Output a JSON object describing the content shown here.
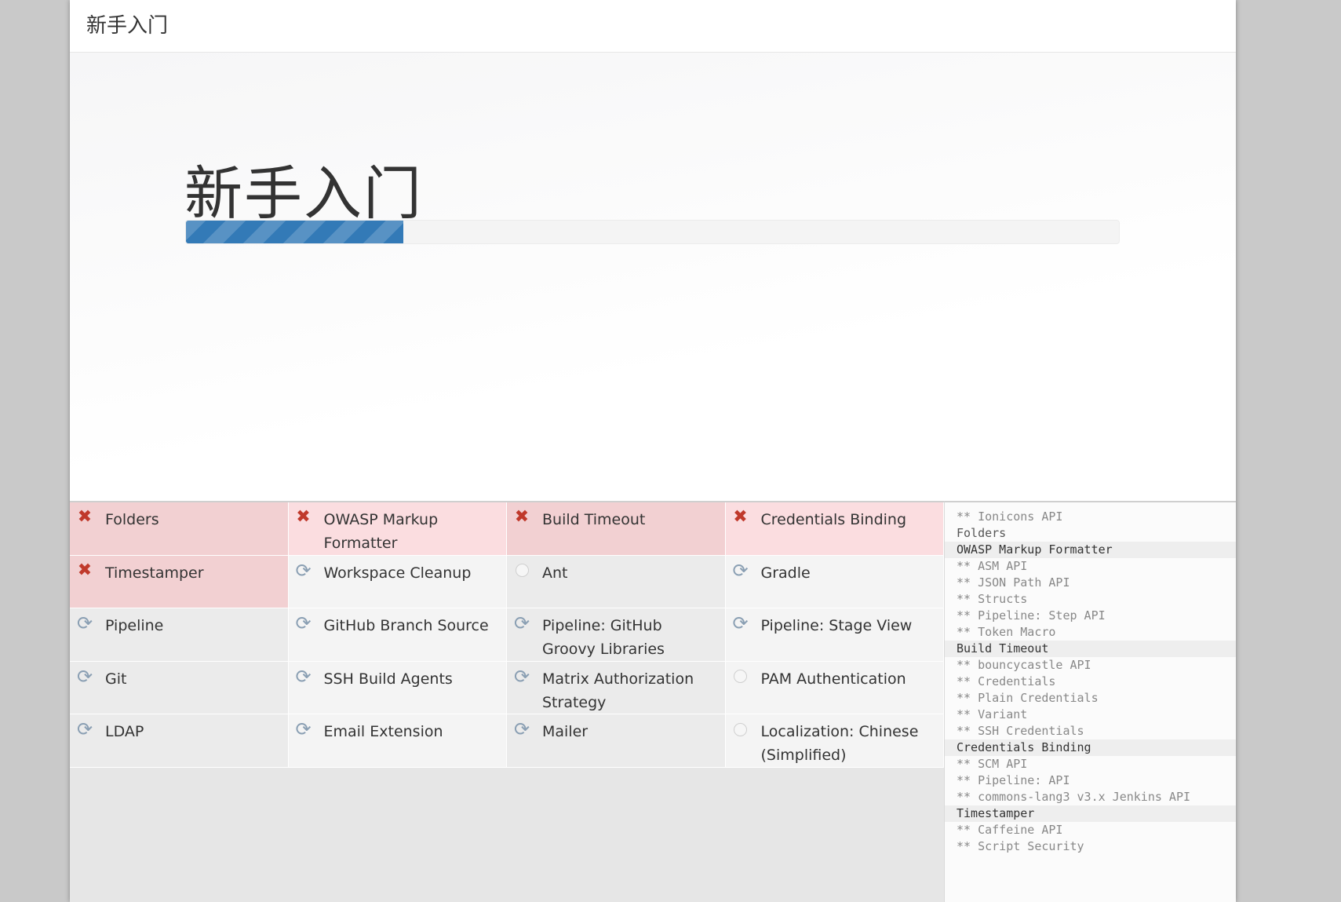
{
  "header": {
    "title": "新手入门"
  },
  "hero": {
    "title": "新手入门",
    "progress_fraction": 0.233
  },
  "plugins": [
    {
      "name": "Folders",
      "status": "failed"
    },
    {
      "name": "OWASP Markup Formatter",
      "status": "failed"
    },
    {
      "name": "Build Timeout",
      "status": "failed"
    },
    {
      "name": "Credentials Binding",
      "status": "failed"
    },
    {
      "name": "Timestamper",
      "status": "failed"
    },
    {
      "name": "Workspace Cleanup",
      "status": "installing"
    },
    {
      "name": "Ant",
      "status": "queued"
    },
    {
      "name": "Gradle",
      "status": "installing"
    },
    {
      "name": "Pipeline",
      "status": "installing"
    },
    {
      "name": "GitHub Branch Source",
      "status": "installing"
    },
    {
      "name": "Pipeline: GitHub Groovy Libraries",
      "status": "installing"
    },
    {
      "name": "Pipeline: Stage View",
      "status": "installing"
    },
    {
      "name": "Git",
      "status": "installing"
    },
    {
      "name": "SSH Build Agents",
      "status": "installing"
    },
    {
      "name": "Matrix Authorization Strategy",
      "status": "installing"
    },
    {
      "name": "PAM Authentication",
      "status": "queued"
    },
    {
      "name": "LDAP",
      "status": "installing"
    },
    {
      "name": "Email Extension",
      "status": "installing"
    },
    {
      "name": "Mailer",
      "status": "installing"
    },
    {
      "name": "Localization: Chinese (Simplified)",
      "status": "queued"
    }
  ],
  "log": [
    {
      "text": "** Ionicons API",
      "type": "dep"
    },
    {
      "text": "Folders",
      "type": "plain"
    },
    {
      "text": "OWASP Markup Formatter",
      "type": "head"
    },
    {
      "text": "** ASM API",
      "type": "dep"
    },
    {
      "text": "** JSON Path API",
      "type": "dep"
    },
    {
      "text": "** Structs",
      "type": "dep"
    },
    {
      "text": "** Pipeline: Step API",
      "type": "dep"
    },
    {
      "text": "** Token Macro",
      "type": "dep"
    },
    {
      "text": "Build Timeout",
      "type": "head"
    },
    {
      "text": "** bouncycastle API",
      "type": "dep"
    },
    {
      "text": "** Credentials",
      "type": "dep"
    },
    {
      "text": "** Plain Credentials",
      "type": "dep"
    },
    {
      "text": "** Variant",
      "type": "dep"
    },
    {
      "text": "** SSH Credentials",
      "type": "dep"
    },
    {
      "text": "Credentials Binding",
      "type": "head"
    },
    {
      "text": "** SCM API",
      "type": "dep"
    },
    {
      "text": "** Pipeline: API",
      "type": "dep"
    },
    {
      "text": "** commons-lang3 v3.x Jenkins API",
      "type": "dep"
    },
    {
      "text": "Timestamper",
      "type": "head"
    },
    {
      "text": "** Caffeine API",
      "type": "dep"
    },
    {
      "text": "** Script Security",
      "type": "dep"
    }
  ],
  "icons": {
    "failed": "x-icon",
    "installing": "refresh-icon",
    "queued": "pending-circle-icon"
  },
  "colors": {
    "progress": "#337ab7",
    "failed_bg": "#f2d0d2",
    "failed_icon": "#c0392b"
  }
}
